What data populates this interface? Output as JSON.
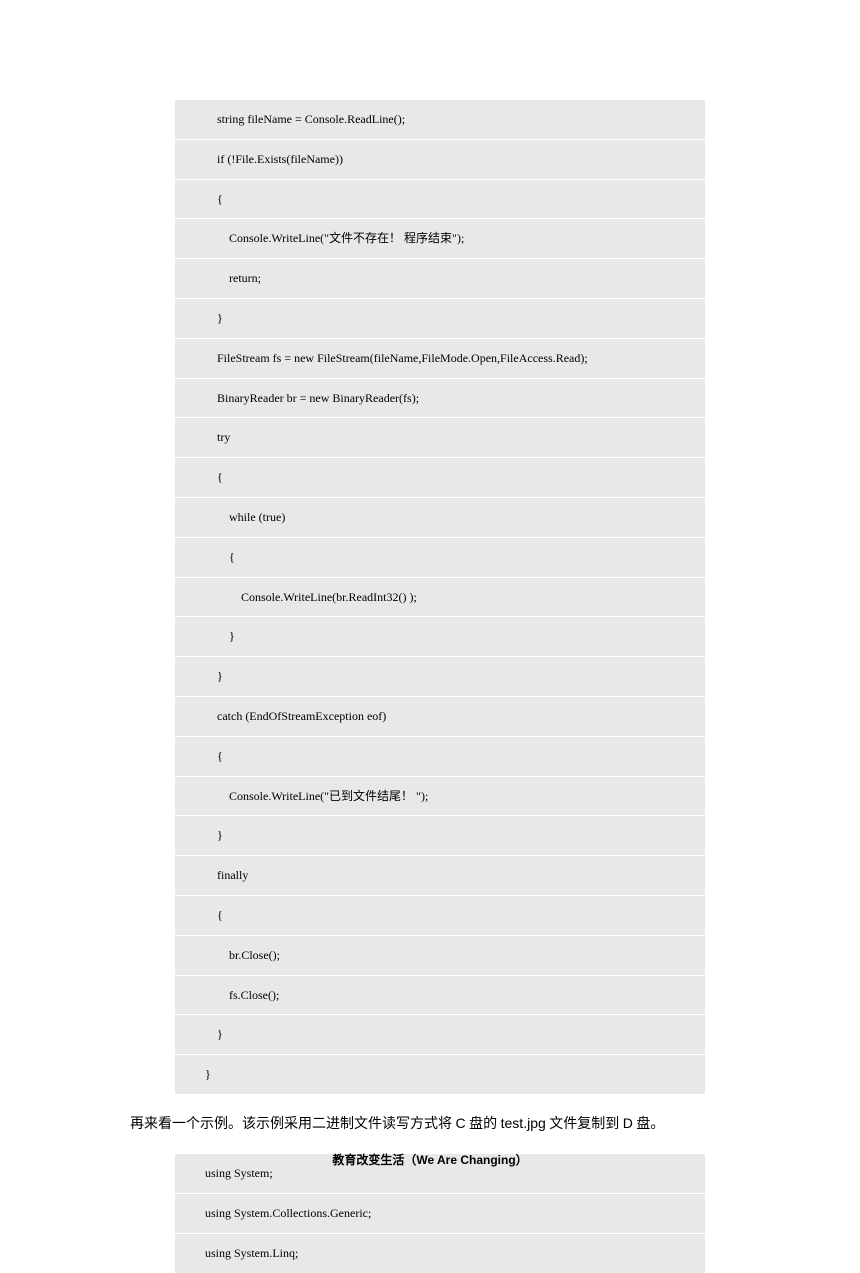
{
  "code1": {
    "lines": [
      "    string fileName = Console.ReadLine();",
      "    if (!File.Exists(fileName))",
      "    {",
      "        Console.WriteLine(\"文件不存在！ 程序结束\");",
      "        return;",
      "    }",
      "    FileStream fs = new FileStream(fileName,FileMode.Open,FileAccess.Read);",
      "    BinaryReader br = new BinaryReader(fs);",
      "    try",
      "    {",
      "        while (true)",
      "        {",
      "            Console.WriteLine(br.ReadInt32() );",
      "        }",
      "    }",
      "    catch (EndOfStreamException eof)",
      "    {",
      "        Console.WriteLine(\"已到文件结尾！ \");",
      "    }",
      "    finally",
      "    {",
      "        br.Close();",
      "        fs.Close();",
      "    }",
      "}"
    ]
  },
  "paragraph": {
    "prefix": "再来看一个示例。该示例采用二进制文件读写方式将 ",
    "c": "C",
    "mid1": " 盘的 ",
    "file": "test.jpg",
    "mid2": " 文件复制到 ",
    "d": "D",
    "suffix": " 盘。"
  },
  "code2": {
    "lines": [
      "using System;",
      "using System.Collections.Generic;",
      "using System.Linq;"
    ]
  },
  "footer": {
    "cn": "教育改变生活（",
    "en": "We Are Changing",
    "close": "）"
  }
}
